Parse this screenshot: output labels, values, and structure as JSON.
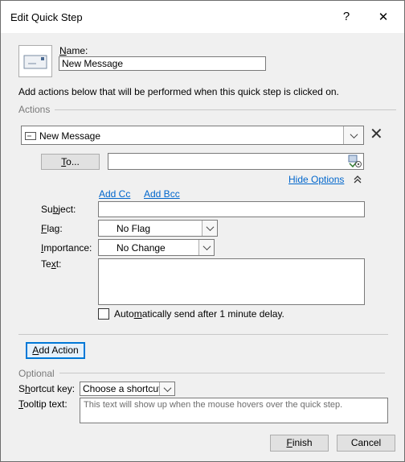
{
  "window": {
    "title": "Edit Quick Step",
    "help_glyph": "?",
    "close_glyph": "✕"
  },
  "name": {
    "label": "Name:",
    "value": "New Message"
  },
  "instructions": "Add actions below that will be performed when this quick step is clicked on.",
  "actions": {
    "group_label": "Actions",
    "action_value": "New Message",
    "remove_glyph": "✕",
    "to_button": "To...",
    "to_value": "",
    "hide_options_link": "Hide Options",
    "add_cc_link": "Add Cc",
    "add_bcc_link": "Add Bcc",
    "subject_label": "Subject:",
    "subject_value": "",
    "flag_label": "Flag:",
    "flag_value": "No Flag",
    "importance_label": "Importance:",
    "importance_value": "No Change",
    "text_label": "Text:",
    "text_value": "",
    "auto_send_label": "Automatically send after 1 minute delay.",
    "auto_send_checked": false
  },
  "add_action_button": "Add Action",
  "optional": {
    "group_label": "Optional",
    "shortcut_label": "Shortcut key:",
    "shortcut_value": "Choose a shortcut",
    "tooltip_label": "Tooltip text:",
    "tooltip_placeholder": "This text will show up when the mouse hovers over the quick step."
  },
  "footer": {
    "finish_button": "Finish",
    "cancel_button": "Cancel"
  }
}
